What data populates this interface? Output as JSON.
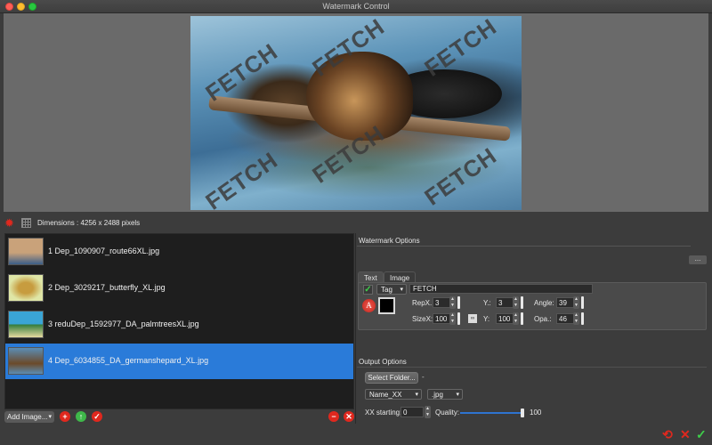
{
  "window": {
    "title": "Watermark Control"
  },
  "preview": {
    "watermark_text": "FETCH"
  },
  "info": {
    "dimensions": "Dimensions : 4256 x 2488 pixels"
  },
  "files": [
    {
      "label": "1 Dep_1090907_route66XL.jpg",
      "selected": false,
      "thumb_colors": [
        "#c9a27a",
        "#3b5e88"
      ]
    },
    {
      "label": "2 Dep_3029217_butterfly_XL.jpg",
      "selected": false,
      "thumb_colors": [
        "#dfe6a6",
        "#c79c3f"
      ]
    },
    {
      "label": "3 reduDep_1592977_DA_palmtreesXL.jpg",
      "selected": false,
      "thumb_colors": [
        "#3aa5d6",
        "#2e7a3a"
      ]
    },
    {
      "label": "4 Dep_6034855_DA_germanshepard_XL.jpg",
      "selected": true,
      "thumb_colors": [
        "#5b8db5",
        "#6b4a2a"
      ]
    }
  ],
  "list_toolbar": {
    "add_image": "Add Image..."
  },
  "watermark_options": {
    "title": "Watermark Options",
    "more": "...",
    "tabs": {
      "text": "Text",
      "image": "Image"
    },
    "enabled": true,
    "mode": "Tag",
    "text_value": "FETCH",
    "font_glyph": "A",
    "color": "#000000",
    "repx_label": "RepX.:",
    "repx": "3",
    "y_rep_label": "Y.:",
    "y_rep": "3",
    "angle_label": "Angle:",
    "angle": "39",
    "sizex_label": "SizeX:",
    "sizex": "100",
    "sizey_label": "Y:",
    "sizey": "100",
    "opacity_label": "Opa.:",
    "opacity": "46"
  },
  "output_options": {
    "title": "Output Options",
    "select_folder": "Select Folder...",
    "folder_path": "-",
    "naming": "Name_XX",
    "format": ".jpg",
    "xx_label": "XX starting:",
    "xx_value": "0",
    "quality_label": "Quality:",
    "quality": "100",
    "quality_fraction": 1.0
  },
  "colors": {
    "accent": "#2a7bd9",
    "danger": "#e0281e",
    "ok": "#3ecf4a"
  }
}
